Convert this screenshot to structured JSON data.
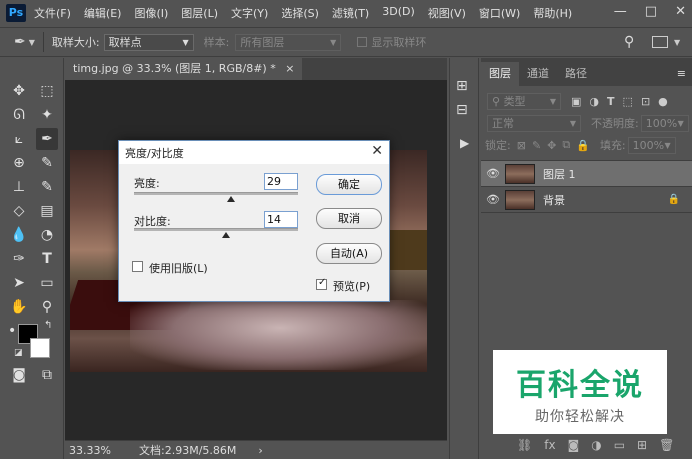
{
  "app": {
    "logo": "Ps"
  },
  "menu": [
    "文件(F)",
    "编辑(E)",
    "图像(I)",
    "图层(L)",
    "文字(Y)",
    "选择(S)",
    "滤镜(T)",
    "3D(D)",
    "视图(V)",
    "窗口(W)",
    "帮助(H)"
  ],
  "window_controls": {
    "minimize": "—",
    "restore": "□",
    "close": "✕"
  },
  "options_bar": {
    "sample_size_label": "取样大小:",
    "sample_size_value": "取样点",
    "sample_label": "样本:",
    "sample_value": "所有图层",
    "show_ring_label": "显示取样环"
  },
  "document": {
    "tab_title": "timg.jpg @ 33.3% (图层 1, RGB/8#) *",
    "tab_close": "×",
    "zoom": "33.33%",
    "doc_info": "文档:2.93M/5.86M",
    "status_arrow": "›"
  },
  "layers_panel": {
    "tabs": [
      "图层",
      "通道",
      "路径"
    ],
    "filter_kind": "类型",
    "blend_mode": "正常",
    "opacity_label": "不透明度:",
    "opacity_value": "100%",
    "lock_label": "锁定:",
    "fill_label": "填充:",
    "fill_value": "100%",
    "layers": [
      {
        "name": "图层 1",
        "visible": true,
        "selected": true
      },
      {
        "name": "背景",
        "visible": true,
        "locked": true
      }
    ]
  },
  "dialog": {
    "title": "亮度/对比度",
    "brightness_label": "亮度:",
    "brightness_value": "29",
    "contrast_label": "对比度:",
    "contrast_value": "14",
    "legacy_label": "使用旧版(L)",
    "legacy_checked": false,
    "preview_label": "预览(P)",
    "preview_checked": true,
    "ok_label": "确定",
    "cancel_label": "取消",
    "auto_label": "自动(A)"
  },
  "watermark": {
    "title": "百科全说",
    "subtitle": "助你轻松解决"
  },
  "colors": {
    "accent": "#31a8ff",
    "watermark_green": "#1aa56b",
    "panel_bg": "#535353"
  }
}
